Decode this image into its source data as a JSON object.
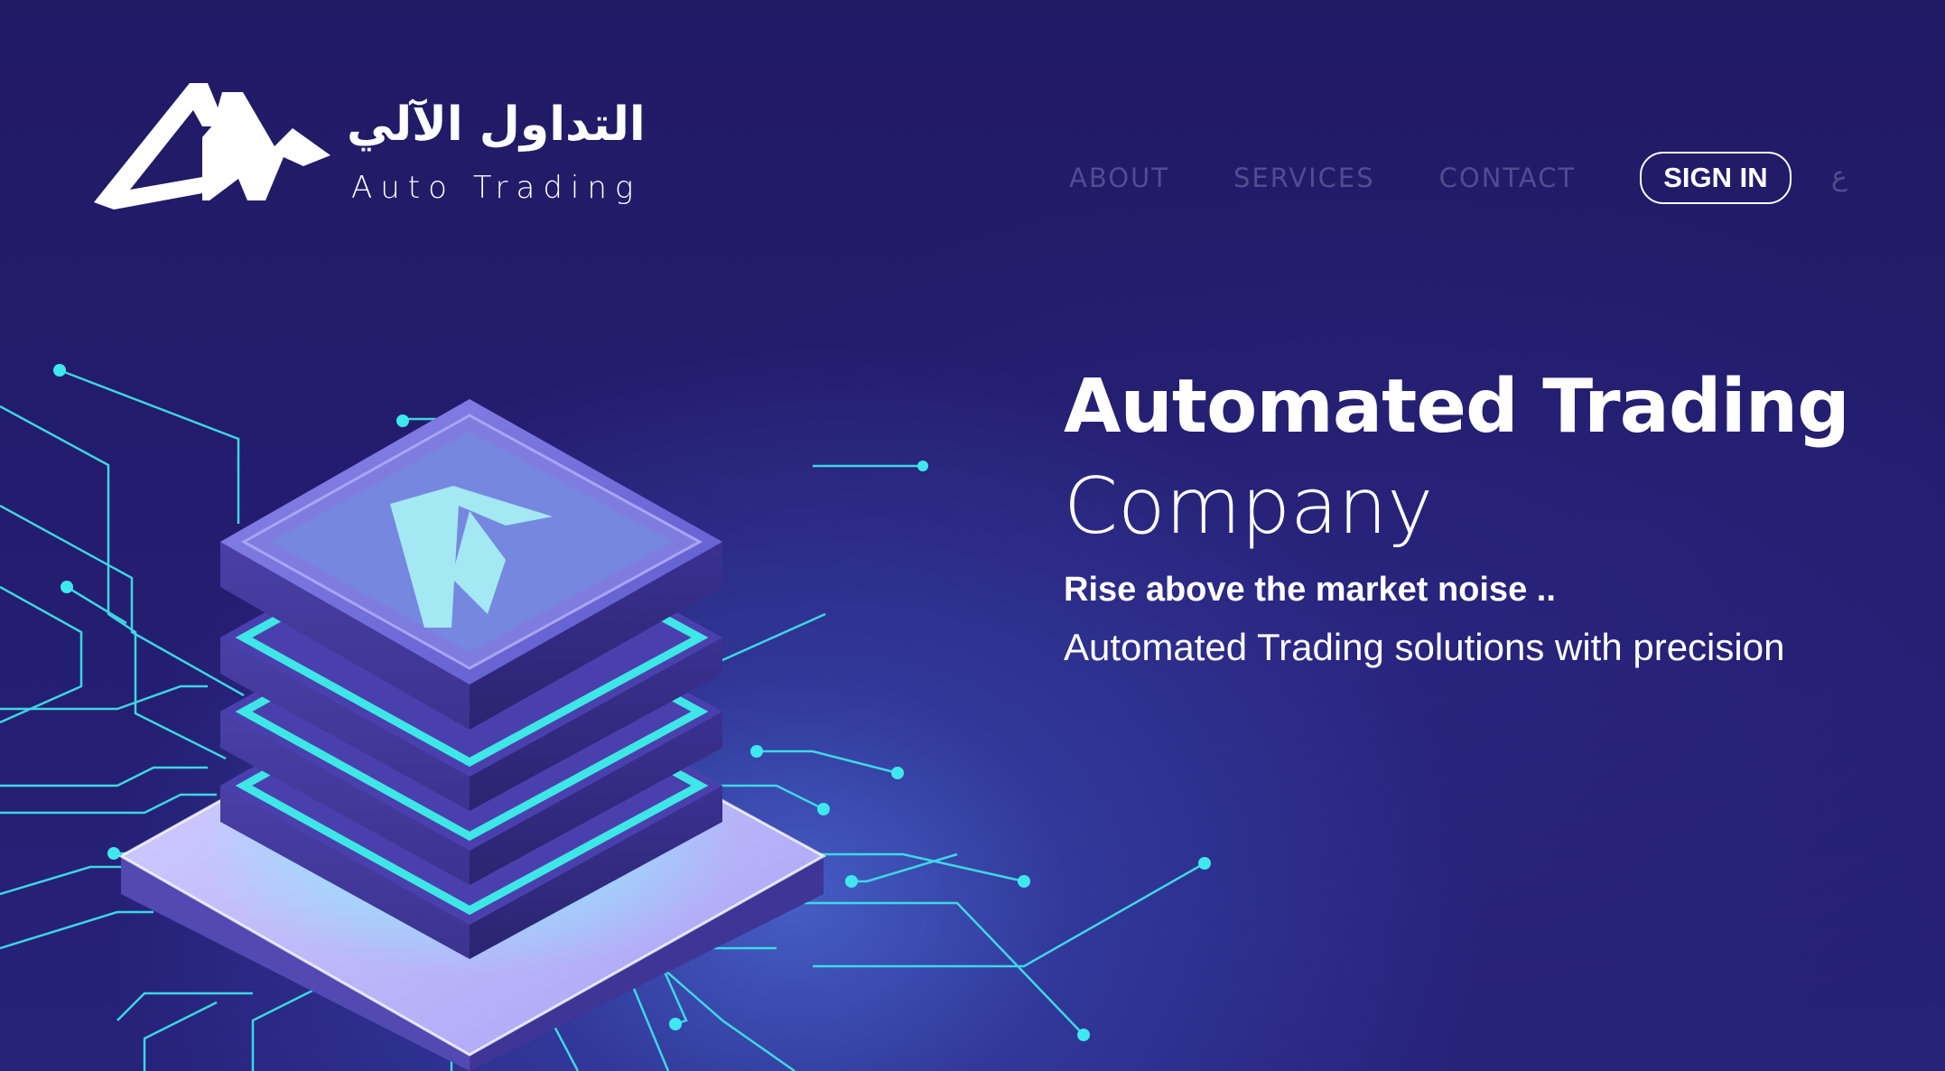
{
  "brand": {
    "name_ar": "التداول الآلي",
    "name_en": "Auto Trading",
    "logo_icon": "at-logo-mark"
  },
  "nav": {
    "items": [
      {
        "label": "ABOUT"
      },
      {
        "label": "SERVICES"
      },
      {
        "label": "CONTACT"
      }
    ],
    "signin_label": "SIGN IN",
    "language_label": "ع"
  },
  "hero": {
    "title_line1": "Automated Trading",
    "title_line2": "Company",
    "tagline": "Rise above the market noise ..",
    "description": "Automated Trading solutions with precision",
    "illustration": "isometric-server-stack-circuit-illustration"
  },
  "colors": {
    "background": "#221a66",
    "accent_cyan": "#3fe6e6",
    "nav_text": "#524c90",
    "text": "#ffffff",
    "stack_purple": "#5a4fc2"
  }
}
